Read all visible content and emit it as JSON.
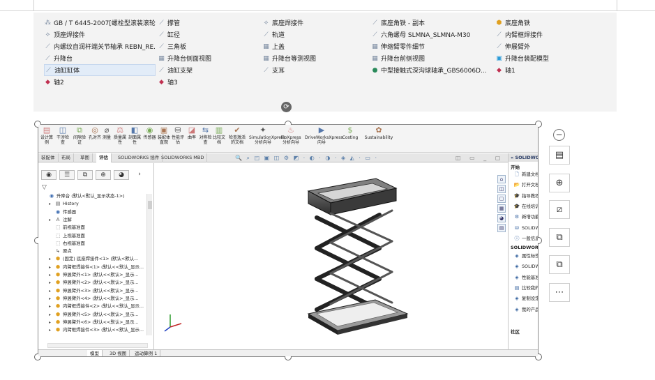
{
  "files": [
    {
      "icon": "⁂",
      "label": "GB / T 6445-2007[螺栓型滚装滚轮..."
    },
    {
      "icon": "⟋",
      "label": "撑管"
    },
    {
      "icon": "⟡",
      "label": "底座焊接件"
    },
    {
      "icon": "⟋",
      "label": "底座角铁 - 副本"
    },
    {
      "icon": "⬢",
      "label": "底座角铁",
      "color": "#e0a020"
    },
    {
      "icon": "⟡",
      "label": "顶座焊接件"
    },
    {
      "icon": "⟋",
      "label": "缸径"
    },
    {
      "icon": "⟋",
      "label": "轨道"
    },
    {
      "icon": "⟋",
      "label": "六角螺母 SLMNA_SLMNA-M30"
    },
    {
      "icon": "⟋",
      "label": "内臂框焊接件"
    },
    {
      "icon": "⟋",
      "label": "内螺纹自润杆端关节轴承 REBN_RE..."
    },
    {
      "icon": "⟋",
      "label": "三角板"
    },
    {
      "icon": "▦",
      "label": "上盖"
    },
    {
      "icon": "▦",
      "label": "伸缩臂零件细节"
    },
    {
      "icon": "⟋",
      "label": "伸展臂外"
    },
    {
      "icon": "⟋",
      "label": "升降台"
    },
    {
      "icon": "▦",
      "label": "升降台侧面视图"
    },
    {
      "icon": "▦",
      "label": "升降台等测视图"
    },
    {
      "icon": "▦",
      "label": "升降台前侧视图"
    },
    {
      "icon": "▣",
      "label": "升降台装配模型",
      "color": "#2b9bd8"
    },
    {
      "icon": "⟋",
      "label": "油缸缸体",
      "selected": true
    },
    {
      "icon": "⟋",
      "label": "油缸支架"
    },
    {
      "icon": "⟋",
      "label": "支耳"
    },
    {
      "icon": "●",
      "label": "中型接触式深沟球轴承_GBS6006D...",
      "color": "#2a8a5a"
    },
    {
      "icon": "◆",
      "label": "轴1",
      "color": "#c03050"
    },
    {
      "icon": "◆",
      "label": "轴2",
      "color": "#c03050"
    },
    {
      "icon": "◆",
      "label": "轴3",
      "color": "#c03050"
    }
  ],
  "rotate_icon": "rotate-icon",
  "toolbar": [
    {
      "icon": "▤",
      "label": "设计算\n例"
    },
    {
      "icon": "◫",
      "label": "干涉检\n查"
    },
    {
      "icon": "⧉",
      "label": "间隙验\n证"
    },
    {
      "icon": "◎",
      "label": "孔对齐"
    },
    {
      "icon": "⌀",
      "label": "测量"
    },
    {
      "icon": "⚖",
      "label": "质量属\n性"
    },
    {
      "icon": "◧",
      "label": "剖面属\n性"
    },
    {
      "icon": "◉",
      "label": "传感器"
    },
    {
      "icon": "▣",
      "label": "装配体\n直观"
    },
    {
      "icon": "⛁",
      "label": "性能评\n估"
    },
    {
      "icon": "◪",
      "label": "曲率"
    },
    {
      "icon": "⇆",
      "label": "对称检\n查"
    },
    {
      "icon": "▥",
      "label": "比较文\n档"
    },
    {
      "icon": "✔",
      "label": "检查激活\n的文档"
    },
    {
      "icon": "✦",
      "label": "SimulationXpress\n分析向导"
    },
    {
      "icon": "♨",
      "label": "FloXpress\n分析向导"
    },
    {
      "icon": "▶",
      "label": "DriveWorksXpress\n向导"
    },
    {
      "icon": "$",
      "label": "Costing"
    },
    {
      "icon": "✿",
      "label": "Sustainability"
    }
  ],
  "tabs": [
    "装配体",
    "布局",
    "草图",
    "评估",
    "SOLIDWORKS 插件",
    "SOLIDWORKS MBD"
  ],
  "active_tab": "评估",
  "view_tools": "🔍 ⌕ ◰ ▣ ◫ ⚙ ◩ · ◐ · ◑ · ◈ ◭ · ▭ ·",
  "window_controls": "◫ ▭ _ ▢ ×",
  "left_tabs": [
    "◉",
    "☰",
    "⧉",
    "⊕",
    "◕"
  ],
  "filter_icon": "▽",
  "tree": [
    {
      "icon": "◉",
      "label": "升降台 (默认<默认_显示状态-1>)",
      "indent": 0,
      "arrow": ""
    },
    {
      "icon": "▤",
      "label": "History",
      "indent": 1,
      "arrow": "▸"
    },
    {
      "icon": "◉",
      "label": "传感器",
      "indent": 1,
      "arrow": ""
    },
    {
      "icon": "A",
      "label": "注解",
      "indent": 1,
      "arrow": "▸"
    },
    {
      "icon": "⬚",
      "label": "前视基准面",
      "indent": 1,
      "arrow": ""
    },
    {
      "icon": "⬚",
      "label": "上视基准面",
      "indent": 1,
      "arrow": ""
    },
    {
      "icon": "⬚",
      "label": "右视基准面",
      "indent": 1,
      "arrow": ""
    },
    {
      "icon": "↳",
      "label": "原点",
      "indent": 1,
      "arrow": ""
    },
    {
      "icon": "⬢",
      "label": "(固定) 底座焊接件<1> (默认<默认...",
      "indent": 1,
      "arrow": "▸"
    },
    {
      "icon": "⬢",
      "label": "内臂框焊接件<1> (默认<<默认_显示...",
      "indent": 1,
      "arrow": "▸"
    },
    {
      "icon": "⬢",
      "label": "伸展臂外<1> (默认<<默认>_显示...",
      "indent": 1,
      "arrow": "▸"
    },
    {
      "icon": "⬢",
      "label": "伸展臂外<2> (默认<<默认>_显示...",
      "indent": 1,
      "arrow": "▸"
    },
    {
      "icon": "⬢",
      "label": "伸展臂外<3> (默认<<默认>_显示...",
      "indent": 1,
      "arrow": "▸"
    },
    {
      "icon": "⬢",
      "label": "伸展臂外<4> (默认<<默认>_显示...",
      "indent": 1,
      "arrow": "▸"
    },
    {
      "icon": "⬢",
      "label": "内臂框焊接件<2> (默认<<默认_显示...",
      "indent": 1,
      "arrow": "▸"
    },
    {
      "icon": "⬢",
      "label": "伸展臂外<5> (默认<<默认>_显示...",
      "indent": 1,
      "arrow": "▸"
    },
    {
      "icon": "⬢",
      "label": "伸展臂外<6> (默认<<默认>_显示...",
      "indent": 1,
      "arrow": "▸"
    },
    {
      "icon": "⬢",
      "label": "内臂框焊接件<3> (默认<<默认_显示...",
      "indent": 1,
      "arrow": "▸"
    }
  ],
  "bottom_tabs": [
    "模型",
    "3D 视图",
    "运动算例 1"
  ],
  "task_pane": {
    "header": "«  SOLIDWORKS",
    "sections": [
      {
        "title": "开始",
        "items": [
          {
            "icon": "🗋",
            "label": "新建文档"
          },
          {
            "icon": "📂",
            "label": "打开文档"
          },
          {
            "icon": "🎓",
            "label": "指导教程"
          },
          {
            "icon": "🎓",
            "label": "在线培训"
          },
          {
            "icon": "⚙",
            "label": "新增功能"
          },
          {
            "icon": "⛁",
            "label": "SOLIDWORKS"
          },
          {
            "icon": "ⓘ",
            "label": "一般信息"
          }
        ]
      },
      {
        "title": "SOLIDWORKS",
        "items": [
          {
            "icon": "◈",
            "label": "属性标签"
          },
          {
            "icon": "◈",
            "label": "SOLIDWORKS"
          },
          {
            "icon": "◈",
            "label": "性能基准"
          },
          {
            "icon": "▤",
            "label": "比较我的分数"
          },
          {
            "icon": "◈",
            "label": "复制设定"
          },
          {
            "icon": "◈",
            "label": "我的产品"
          }
        ]
      },
      {
        "title": "社区",
        "items": []
      }
    ]
  },
  "right_panel": {
    "collapse": "−",
    "buttons": [
      "▤",
      "⊕",
      "⧄",
      "⧉",
      "⧉",
      "⋯"
    ]
  }
}
